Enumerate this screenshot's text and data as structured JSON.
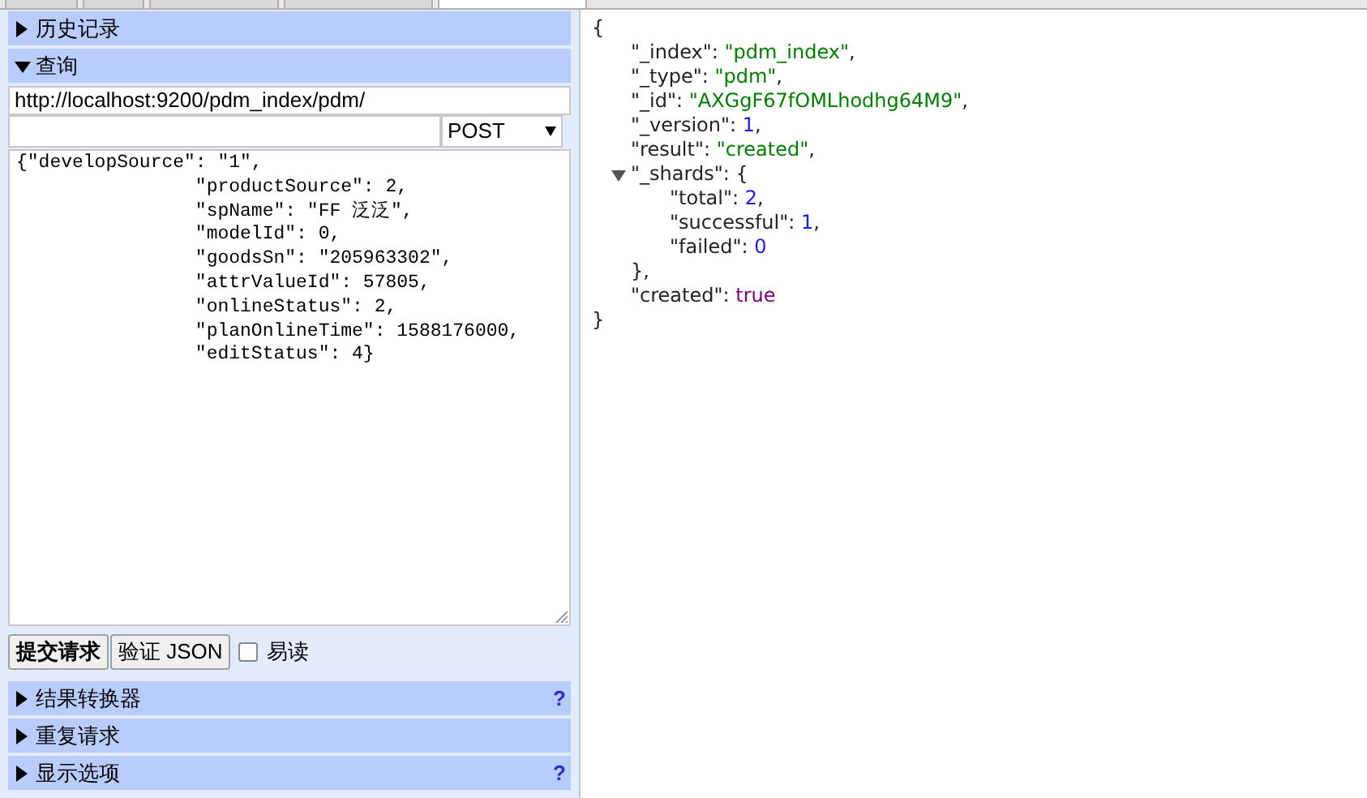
{
  "tabs": [
    {
      "selected": false
    },
    {
      "selected": false
    },
    {
      "selected": false
    },
    {
      "selected": false
    },
    {
      "selected": true
    }
  ],
  "top_sections": [
    {
      "label": "历史记录",
      "expanded": false
    },
    {
      "label": "查询",
      "expanded": true
    }
  ],
  "query": {
    "url": "http://localhost:9200/pdm_index/pdm/",
    "method": "POST",
    "body": "{\"developSource\": \"1\",\n                \"productSource\": 2,\n                \"spName\": \"FF 泛泛\",\n                \"modelId\": 0,\n                \"goodsSn\": \"205963302\",\n                \"attrValueId\": 57805,\n                \"onlineStatus\": 2,\n                \"planOnlineTime\": 1588176000,\n                \"editStatus\": 4}",
    "buttons": [
      "提交请求",
      "验证 JSON"
    ],
    "pretty": {
      "label": "易读",
      "checked": false
    }
  },
  "bottom_sections": [
    {
      "label": "结果转换器",
      "expanded": false,
      "help_text": "?"
    },
    {
      "label": "重复请求",
      "expanded": false
    },
    {
      "label": "显示选项",
      "expanded": false,
      "help_text": "?"
    }
  ],
  "response": {
    "open": "{",
    "close": "}",
    "members": [
      {
        "key": "\"_index\":",
        "kind": "string",
        "value": "\"pdm_index\"",
        "trailer": ","
      },
      {
        "key": "\"_type\":",
        "kind": "string",
        "value": "\"pdm\"",
        "trailer": ","
      },
      {
        "key": "\"_id\":",
        "kind": "string",
        "value": "\"AXGgF67fOMLhodhg64M9\"",
        "trailer": ","
      },
      {
        "key": "\"_version\":",
        "kind": "number",
        "value": "1",
        "trailer": ","
      },
      {
        "key": "\"result\":",
        "kind": "string",
        "value": "\"created\"",
        "trailer": ","
      },
      {
        "key": "\"_shards\":",
        "kind": "object",
        "open": "{",
        "close": "},",
        "expanded": true,
        "children": [
          {
            "key": "\"total\":",
            "kind": "number",
            "value": "2",
            "trailer": ","
          },
          {
            "key": "\"successful\":",
            "kind": "number",
            "value": "1",
            "trailer": ","
          },
          {
            "key": "\"failed\":",
            "kind": "number",
            "value": "0"
          }
        ]
      },
      {
        "key": "\"created\":",
        "kind": "boolean",
        "value": "true"
      }
    ]
  }
}
